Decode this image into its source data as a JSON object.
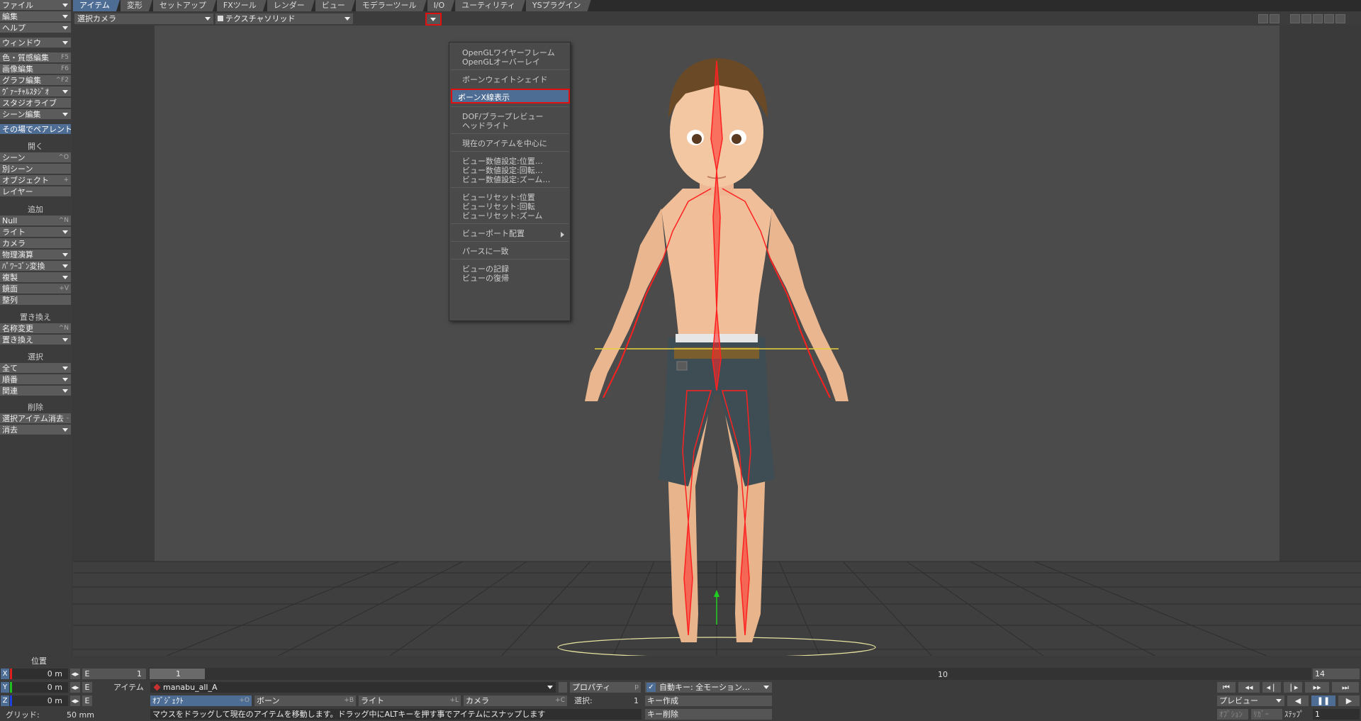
{
  "tabs": [
    "アイテム",
    "変形",
    "セットアップ",
    "FXツール",
    "レンダー",
    "ビュー",
    "モデラーツール",
    "I/O",
    "ユーティリティ",
    "YSプラグイン"
  ],
  "left_toolbar": {
    "file": "ファイル",
    "edit": "編集",
    "help": "ヘルプ",
    "window": "ウィンドウ",
    "surface_editor": "色・質感編集",
    "surface_editor_key": "F5",
    "image_editor": "画像編集",
    "image_editor_key": "F6",
    "graph_editor": "グラフ編集",
    "graph_editor_key": "^F2",
    "virtual_studio": "ｳﾞｧｰﾁｬﾙｽﾀｼﾞｵ",
    "studio_live": "スタジオライブ",
    "scene_editor": "シーン編集",
    "parent_in_place": "その場でペアレント",
    "open_header": "開く",
    "scene": "シーン",
    "scene_key": "^O",
    "other_scene": "別シーン",
    "object": "オブジェクト",
    "object_key": "+",
    "layer": "レイヤー",
    "add_header": "追加",
    "null": "Null",
    "null_key": "^N",
    "light": "ライト",
    "camera": "カメラ",
    "dynamics": "物理演算",
    "poly_convert": "ﾊﾟﾜｰｺﾞﾝ変換",
    "clone": "複製",
    "mirror": "鏡面",
    "mirror_key": "+V",
    "align": "整列",
    "replace_header": "置き換え",
    "rename": "名称変更",
    "rename_key": "^N",
    "replace": "置き換え",
    "select_header": "選択",
    "all": "全て",
    "order": "順番",
    "related": "関連",
    "delete_header": "削除",
    "clear_selected": "選択アイテム消去",
    "clear_selected_key": "-",
    "clear": "消去"
  },
  "viewport": {
    "camera_select": "選択カメラ",
    "render_mode": "テクスチャソリッド"
  },
  "menu": {
    "items": [
      {
        "label": "OpenGLワイヤーフレーム"
      },
      {
        "label": "OpenGLオーバーレイ"
      },
      {
        "label": "ボーンウェイトシェイド"
      },
      {
        "label": "ボーンX線表示",
        "checked": true
      },
      {
        "label": "DOF/ブラープレビュー"
      },
      {
        "label": "ヘッドライト"
      },
      {
        "label": "現在のアイテムを中心に"
      },
      {
        "label": "ビュー数値設定:位置…"
      },
      {
        "label": "ビュー数値設定:回転…"
      },
      {
        "label": "ビュー数値設定:ズーム…"
      },
      {
        "label": "ビューリセット:位置"
      },
      {
        "label": "ビューリセット:回転"
      },
      {
        "label": "ビューリセット:ズーム"
      },
      {
        "label": "ビューポート配置"
      },
      {
        "label": "パースに一致"
      },
      {
        "label": "ビューの記録"
      },
      {
        "label": "ビューの復帰"
      }
    ],
    "checkmark": "✓"
  },
  "bottom": {
    "position_label": "位置",
    "x_label": "X",
    "y_label": "Y",
    "z_label": "Z",
    "x_val": "0 m",
    "y_val": "0 m",
    "z_val": "0 m",
    "e": "E",
    "grid_label": "グリッド:",
    "grid_val": "50 mm",
    "frame_start": "1",
    "timeline_cursor": "1",
    "tick_10": "10",
    "frame_end": "14",
    "item_label": "アイテム",
    "item_name": "manabu_all_A",
    "properties": "プロパティ",
    "properties_key": "p",
    "auto_key": "自動キー: 全モーション…",
    "objects": "ｵﾌﾞｼﾞｪｸﾄ",
    "objects_key": "+O",
    "bones": "ボーン",
    "bones_key": "+B",
    "lights": "ライト",
    "lights_key": "+L",
    "cameras": "カメラ",
    "cameras_key": "+C",
    "selected_label": "選択:",
    "selected_count": "1",
    "create_key": "キー作成",
    "delete_key": "キー削除",
    "status": "マウスをドラッグして現在のアイテムを移動します。ドラッグ中にALTキーを押す事でアイテムにスナップします",
    "preview": "プレビュー",
    "step_label": "ｽﾃｯﾌﾟ",
    "step_val": "1",
    "options_label": "ｵﾌﾟｼｮﾝ",
    "edit_label": "ﾘｶﾞｰ"
  }
}
